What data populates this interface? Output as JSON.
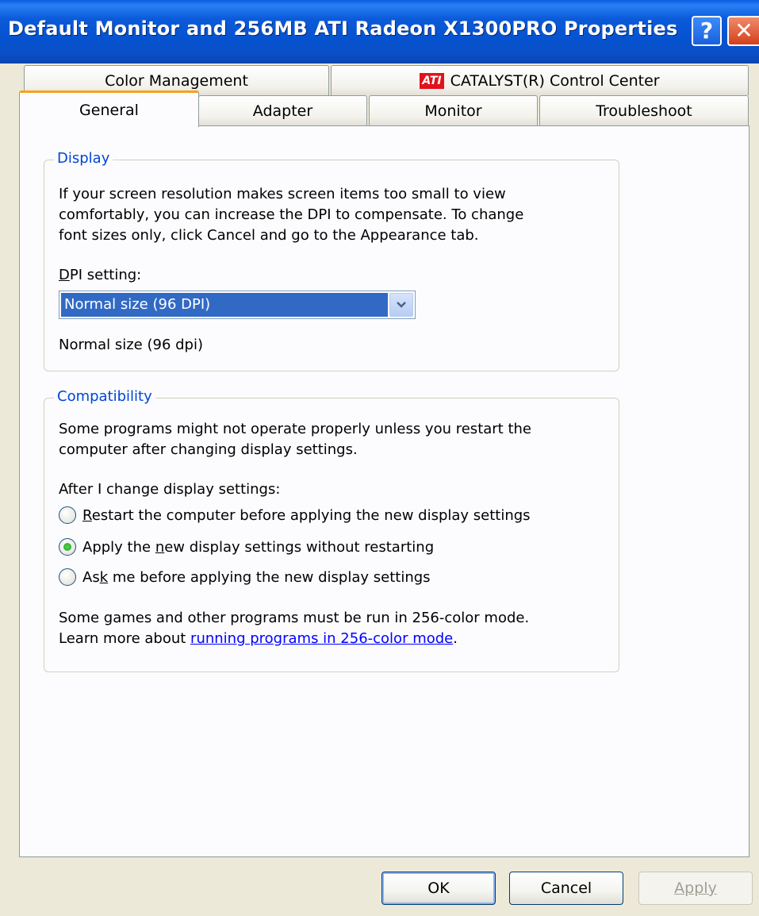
{
  "window": {
    "title": "Default Monitor and 256MB ATI Radeon X1300PRO  Properties",
    "help_symbol": "?",
    "close_symbol": "✕"
  },
  "tabs": {
    "row1": [
      {
        "label": "Color Management"
      },
      {
        "label": "CATALYST(R) Control Center",
        "logo": "ATI"
      }
    ],
    "row2": [
      {
        "label": "General",
        "active": true
      },
      {
        "label": "Adapter"
      },
      {
        "label": "Monitor"
      },
      {
        "label": "Troubleshoot"
      }
    ]
  },
  "display": {
    "legend": "Display",
    "desc_line1": "If your screen resolution makes screen items too small to view",
    "desc_line2": "comfortably, you can increase the DPI to compensate.  To change",
    "desc_line3": "font sizes only, click Cancel and go to the Appearance tab.",
    "dpi_label_mnemonic": "D",
    "dpi_label_rest": "PI setting:",
    "dpi_selected": "Normal size (96 DPI)",
    "dpi_note": "Normal size (96 dpi)"
  },
  "compatibility": {
    "legend": "Compatibility",
    "desc_line1": "Some programs might not operate properly unless you restart the",
    "desc_line2": "computer after changing display settings.",
    "after_label": "After I change display settings:",
    "options": [
      {
        "pre": "",
        "mnemonic": "R",
        "post": "estart the computer before applying the new display settings",
        "selected": false
      },
      {
        "pre": "Apply the ",
        "mnemonic": "n",
        "post": "ew display settings without restarting",
        "selected": true
      },
      {
        "pre": "As",
        "mnemonic": "k",
        "post": " me before applying the new display settings",
        "selected": false
      }
    ],
    "games_line1": "Some games and other programs must be run in 256-color mode.",
    "games_line2_prefix": "Learn more about ",
    "games_link": "running programs in 256-color mode",
    "games_line2_suffix": "."
  },
  "buttons": {
    "ok": "OK",
    "cancel": "Cancel",
    "apply": "Apply"
  },
  "colors": {
    "title_bar": "#0553d0",
    "selection": "#316ac5",
    "legend_text": "#0046d5",
    "active_tab_accent": "#f5a21d",
    "radio_selected": "#21a121",
    "close_button": "#d2401a"
  }
}
